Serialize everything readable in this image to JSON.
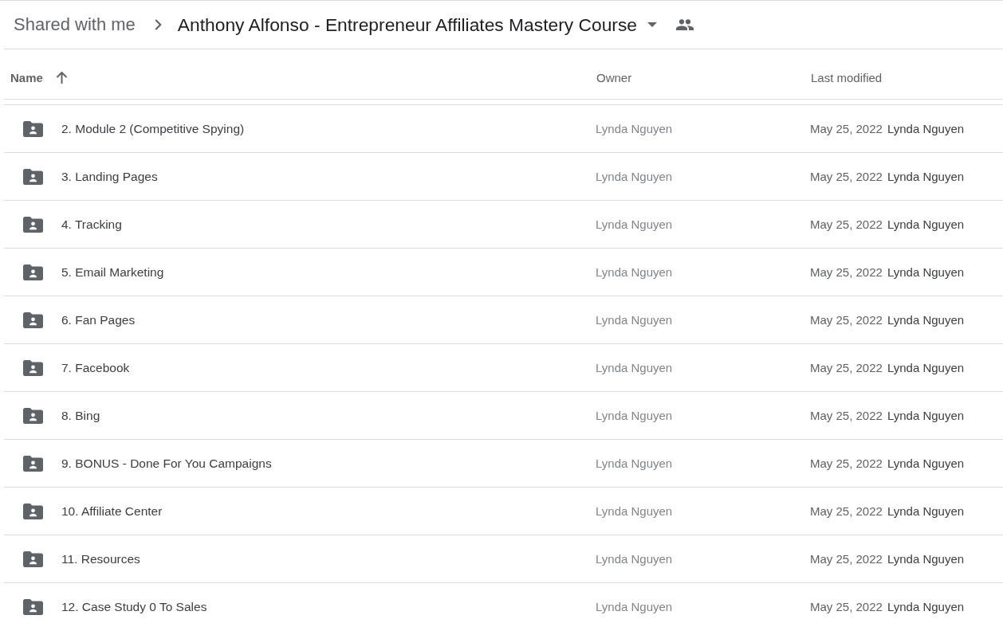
{
  "breadcrumb": {
    "parent": "Shared with me",
    "current": "Anthony Alfonso - Entrepreneur Affiliates Mastery Course"
  },
  "table": {
    "columns": [
      {
        "label": "Name",
        "sorted": true,
        "ascending": true
      },
      {
        "label": "Owner",
        "sorted": false
      },
      {
        "label": "Last modified",
        "sorted": false
      }
    ],
    "rows": [
      {
        "kind": "shared_folder",
        "name": "2. Module 2 (Competitive Spying)",
        "owner": "Lynda Nguyen",
        "modified_date": "May 25, 2022",
        "modified_by": "Lynda Nguyen"
      },
      {
        "kind": "shared_folder",
        "name": "3. Landing Pages",
        "owner": "Lynda Nguyen",
        "modified_date": "May 25, 2022",
        "modified_by": "Lynda Nguyen"
      },
      {
        "kind": "shared_folder",
        "name": "4. Tracking",
        "owner": "Lynda Nguyen",
        "modified_date": "May 25, 2022",
        "modified_by": "Lynda Nguyen"
      },
      {
        "kind": "shared_folder",
        "name": "5. Email Marketing",
        "owner": "Lynda Nguyen",
        "modified_date": "May 25, 2022",
        "modified_by": "Lynda Nguyen"
      },
      {
        "kind": "shared_folder",
        "name": "6. Fan Pages",
        "owner": "Lynda Nguyen",
        "modified_date": "May 25, 2022",
        "modified_by": "Lynda Nguyen"
      },
      {
        "kind": "shared_folder",
        "name": "7. Facebook",
        "owner": "Lynda Nguyen",
        "modified_date": "May 25, 2022",
        "modified_by": "Lynda Nguyen"
      },
      {
        "kind": "shared_folder",
        "name": "8. Bing",
        "owner": "Lynda Nguyen",
        "modified_date": "May 25, 2022",
        "modified_by": "Lynda Nguyen"
      },
      {
        "kind": "shared_folder",
        "name": "9. BONUS - Done For You Campaigns",
        "owner": "Lynda Nguyen",
        "modified_date": "May 25, 2022",
        "modified_by": "Lynda Nguyen"
      },
      {
        "kind": "shared_folder",
        "name": "10. Affiliate Center",
        "owner": "Lynda Nguyen",
        "modified_date": "May 25, 2022",
        "modified_by": "Lynda Nguyen"
      },
      {
        "kind": "shared_folder",
        "name": "11. Resources",
        "owner": "Lynda Nguyen",
        "modified_date": "May 25, 2022",
        "modified_by": "Lynda Nguyen"
      },
      {
        "kind": "shared_folder",
        "name": "12. Case Study 0 To Sales",
        "owner": "Lynda Nguyen",
        "modified_date": "May 25, 2022",
        "modified_by": "Lynda Nguyen"
      }
    ]
  }
}
